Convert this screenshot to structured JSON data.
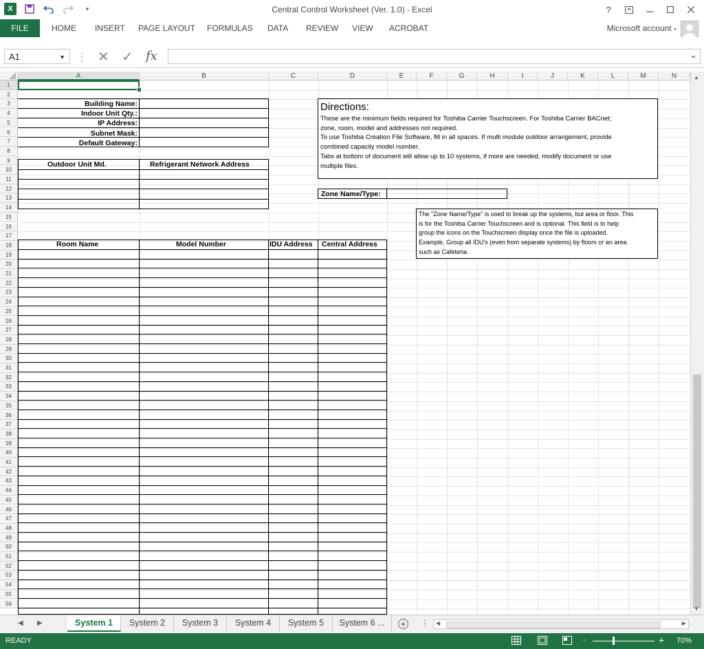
{
  "window": {
    "title": "Central Control Worksheet (Ver. 1.0) - Excel",
    "logo_text": "X",
    "help": "?",
    "account": "Microsoft account"
  },
  "ribbon": {
    "tabs": [
      "FILE",
      "HOME",
      "INSERT",
      "PAGE LAYOUT",
      "FORMULAS",
      "DATA",
      "REVIEW",
      "VIEW",
      "ACROBAT"
    ]
  },
  "formula_bar": {
    "name_box": "A1",
    "fx": "fx",
    "value": ""
  },
  "columns": [
    "A",
    "B",
    "C",
    "D",
    "E",
    "F",
    "G",
    "H",
    "I",
    "J",
    "K",
    "L",
    "M",
    "N"
  ],
  "rows": [
    "1",
    "2",
    "3",
    "4",
    "5",
    "6",
    "7",
    "8",
    "9",
    "10",
    "11",
    "12",
    "13",
    "14",
    "15",
    "16",
    "17",
    "18",
    "19",
    "20",
    "21",
    "22",
    "23",
    "24",
    "25",
    "26",
    "27",
    "28",
    "29",
    "30",
    "31",
    "32",
    "33",
    "34",
    "35",
    "36",
    "37",
    "38",
    "39",
    "40",
    "41",
    "42",
    "43",
    "44",
    "45",
    "46",
    "47",
    "48",
    "49",
    "50",
    "51",
    "52",
    "53",
    "54",
    "55",
    "56"
  ],
  "sheet": {
    "building_name": "Building Name:",
    "indoor_unit_qty": "Indoor Unit Qty.:",
    "ip_address": "IP Address:",
    "subnet_mask": "Subnet Mask:",
    "default_gateway": "Default Gateway:",
    "outdoor_unit_md": "Outdoor Unit Md.",
    "refrigerant_network_address": "Refrigerant Network Address",
    "zone_name_type": "Zone Name/Type:",
    "room_name": "Room Name",
    "model_number": "Model Number",
    "idu_address": "IDU Address",
    "central_address": "Central Address",
    "directions_title": "Directions:",
    "directions_lines": [
      "These are the minimum fields required for Toshiba Carrier Touchscreen. For Toshiba Carrier BACnet;",
      "zone, room, model and addresses not required.",
      "To use Toshiba Creation File Software, fill in all spaces. If multi module outdoor arrangement, provide",
      "combined capacity model number.",
      "Tabs at bottom of document will allow up to 10 systems, if more are needed, modify document or use",
      "multiple files."
    ],
    "zone_note_lines": [
      "The \"Zone Name/Type\" is used to break up the systems, but area or floor. This",
      "is for the Toshiba Carrier Touchscreen and is optional. This field is to help",
      "group the icons on the Touchscreen display once the file is uploaded.",
      "Example, Group all IDU's (even from separate systems) by floors or an area",
      "such as Cafeteria."
    ]
  },
  "sheet_tabs": [
    "System 1",
    "System 2",
    "System 3",
    "System 4",
    "System 5",
    "System 6 ..."
  ],
  "status": {
    "ready": "READY",
    "zoom": "70%",
    "zoom_minus": "-",
    "zoom_plus": "+"
  },
  "colors": {
    "accent": "#217346",
    "file_tab": "#1e7145"
  }
}
